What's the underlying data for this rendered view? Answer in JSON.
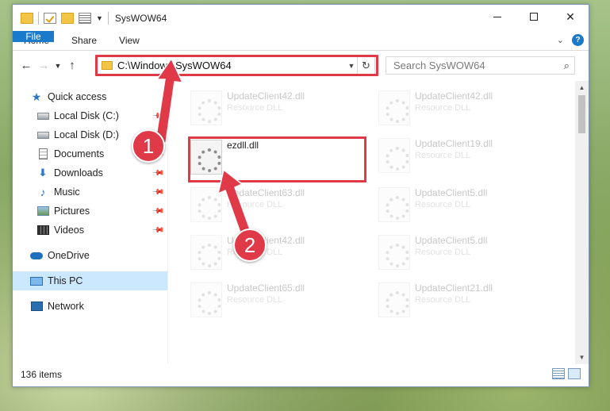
{
  "window": {
    "title": "SysWOW64",
    "controls": {
      "minimize": "—",
      "maximize": "☐",
      "close": "✕"
    }
  },
  "ribbon": {
    "tabs": [
      "File",
      "Home",
      "Share",
      "View"
    ],
    "help": "?"
  },
  "address": {
    "path": "C:\\Windows\\SysWOW64",
    "search_placeholder": "Search SysWOW64"
  },
  "nav": {
    "quick_access": "Quick access",
    "items": [
      {
        "label": "Local Disk (C:)",
        "icon": "disk-icon",
        "pinned": true
      },
      {
        "label": "Local Disk (D:)",
        "icon": "disk-icon",
        "pinned": true
      },
      {
        "label": "Documents",
        "icon": "document-icon",
        "pinned": true
      },
      {
        "label": "Downloads",
        "icon": "download-icon",
        "pinned": true
      },
      {
        "label": "Music",
        "icon": "music-icon",
        "pinned": true
      },
      {
        "label": "Pictures",
        "icon": "pictures-icon",
        "pinned": true
      },
      {
        "label": "Videos",
        "icon": "videos-icon",
        "pinned": true
      }
    ],
    "onedrive": "OneDrive",
    "this_pc": "This PC",
    "network": "Network"
  },
  "files": {
    "highlighted": {
      "name": "ezdll.dll"
    },
    "ghost": [
      {
        "name": "UpdateClient42.dll",
        "type": "Resource DLL"
      },
      {
        "name": "UpdateClient42.dll",
        "type": "Resource DLL"
      },
      {
        "name": "UpdateClient19.dll",
        "type": "Resource DLL"
      },
      {
        "name": "UpdateClient63.dll",
        "type": "Resource DLL"
      },
      {
        "name": "UpdateClient5.dll",
        "type": "Resource DLL"
      },
      {
        "name": "UpdateClient42.dll",
        "type": "Resource DLL"
      },
      {
        "name": "UpdateClient5.dll",
        "type": "Resource DLL"
      },
      {
        "name": "UpdateClient65.dll",
        "type": "Resource DLL"
      },
      {
        "name": "UpdateClient21.dll",
        "type": "Resource DLL"
      }
    ]
  },
  "status": {
    "items": "136 items"
  },
  "annotations": {
    "step1": "1",
    "step2": "2",
    "accent": "#e03a48"
  }
}
